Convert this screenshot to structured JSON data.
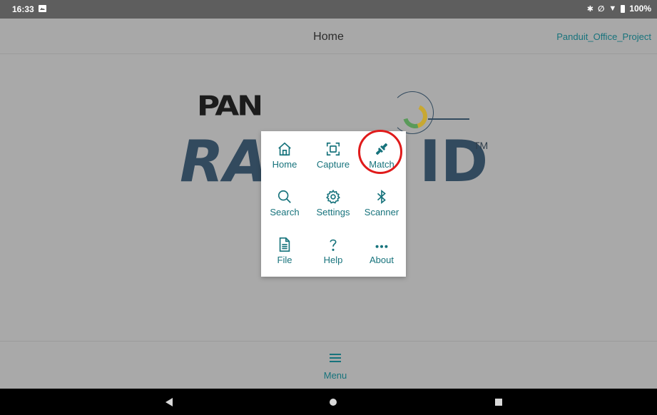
{
  "status_bar": {
    "time": "16:33",
    "battery": "100%"
  },
  "app_bar": {
    "title": "Home",
    "project": "Panduit_Office_Project"
  },
  "logo": {
    "top": "PAN",
    "main_left": "RA",
    "main_right": "ID",
    "tm": "TM"
  },
  "popup_menu": {
    "items": [
      {
        "label": "Home",
        "icon": "home-icon"
      },
      {
        "label": "Capture",
        "icon": "capture-icon"
      },
      {
        "label": "Match",
        "icon": "match-icon"
      },
      {
        "label": "Search",
        "icon": "search-icon"
      },
      {
        "label": "Settings",
        "icon": "gear-icon"
      },
      {
        "label": "Scanner",
        "icon": "bluetooth-icon"
      },
      {
        "label": "File",
        "icon": "file-icon"
      },
      {
        "label": "Help",
        "icon": "help-icon"
      },
      {
        "label": "About",
        "icon": "more-icon"
      }
    ],
    "accent": "#17737c",
    "highlight_color": "#e01b1b"
  },
  "bottom_bar": {
    "menu_label": "Menu"
  }
}
